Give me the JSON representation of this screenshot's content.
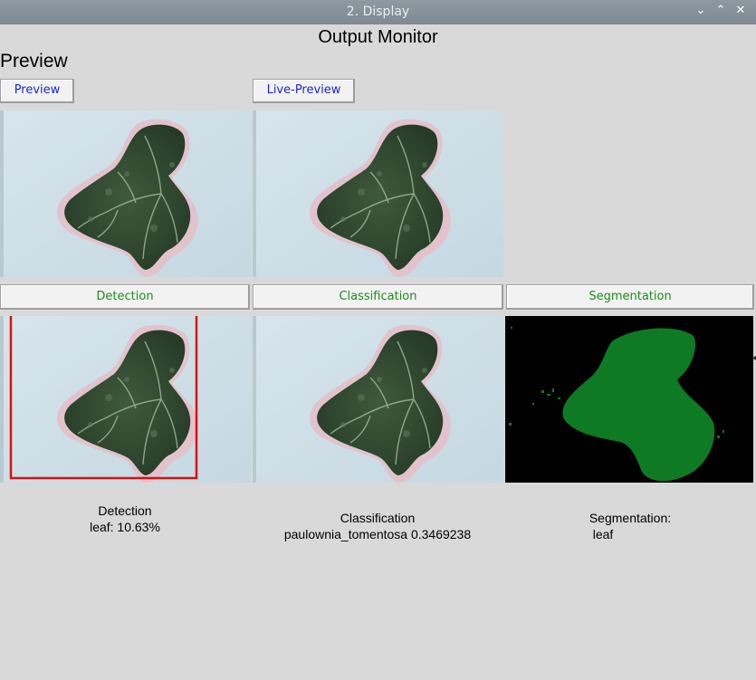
{
  "window": {
    "title": "2. Display",
    "controls": [
      "⌄",
      "⌃",
      "✕"
    ]
  },
  "main": {
    "heading": "Output Monitor",
    "section_label": "Preview"
  },
  "buttons": {
    "preview": "Preview",
    "live_preview": "Live-Preview"
  },
  "tabs": {
    "detection": "Detection",
    "classification": "Classification",
    "segmentation": "Segmentation"
  },
  "results": {
    "detection": {
      "title": "Detection",
      "value": "leaf: 10.63%"
    },
    "classification": {
      "title": "Classification",
      "value": "paulownia_tomentosa 0.3469238"
    },
    "segmentation": {
      "title": "Segmentation:",
      "value": "leaf"
    }
  },
  "colors": {
    "label_blue": "#1f25c8",
    "label_green": "#1a8c1a",
    "bbox_red": "#d91010",
    "mask_green": "#0f7a24"
  }
}
